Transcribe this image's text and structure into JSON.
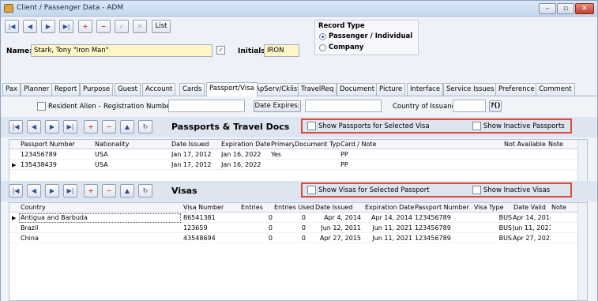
{
  "window": {
    "title": "Client / Passenger Data - ADM"
  },
  "toolbar": {
    "list_label": "List"
  },
  "name": {
    "label": "Name:",
    "value": "Stark, Tony \"Iron Man\"",
    "initials_label": "Initials:",
    "initials_value": "IRON"
  },
  "record_type": {
    "label": "Record Type",
    "options": [
      "Passenger / Individual",
      "Company"
    ],
    "selected": "Passenger / Individual"
  },
  "tabs": [
    "Pax",
    "Planner",
    "Report",
    "Purpose",
    "Guest",
    "Account",
    "Cards",
    "Passport/Visa",
    "ApServ/Cklist",
    "TravelReq",
    "Document",
    "Picture",
    "Interface",
    "Service Issues",
    "Preference",
    "Comment"
  ],
  "active_tab": "Passport/Visa",
  "resident": {
    "resident_alien_label": "Resident Alien -",
    "registration_label": "Registration Number:",
    "date_expires_label": "Date Expires:",
    "country_label": "Country of Issuance:",
    "lookup_label": "?()"
  },
  "passports": {
    "title": "Passports & Travel Docs",
    "show_selected_label": "Show Passports for Selected Visa",
    "show_inactive_label": "Show Inactive Passports",
    "columns": [
      "Passport Number",
      "Nationality",
      "Date Issued",
      "Expiration Date",
      "Primary",
      "Document Type",
      "Card / Note",
      "Not Available",
      "Note"
    ],
    "rows": [
      [
        "123456789",
        "USA",
        "Jan 17, 2012",
        "Jan 16, 2022",
        "Yes",
        "PP",
        "",
        "",
        ""
      ],
      [
        "135438439",
        "USA",
        "Jan 17, 2012",
        "Jan 16, 2022",
        "",
        "PP",
        "",
        "",
        ""
      ]
    ]
  },
  "visas": {
    "title": "Visas",
    "show_selected_label": "Show Visas for Selected Passport",
    "show_inactive_label": "Show Inactive Visas",
    "columns": [
      "Country",
      "Visa Number",
      "Entries",
      "Entries Used",
      "Date Issued",
      "Expiration Date",
      "Passport Number",
      "Visa Type",
      "Date Valid",
      "Note"
    ],
    "rows": [
      [
        "Antigua and Barbuda",
        "86541381",
        "0",
        "0",
        "Apr 4, 2014",
        "Apr 14, 2014",
        "123456789",
        "BUS",
        "Apr 14, 2014",
        ""
      ],
      [
        "Brazil",
        "123659",
        "0",
        "0",
        "Jun 12, 2011",
        "Jun 11, 2021",
        "123456789",
        "BUS",
        "Jun 11, 2021",
        ""
      ],
      [
        "China",
        "43548694",
        "0",
        "0",
        "Apr 27, 2015",
        "Jun 11, 2021",
        "123456789",
        "BUS",
        "Apr 27, 2025",
        ""
      ]
    ]
  },
  "icons": {
    "first": "first-record-icon",
    "prev": "previous-record-icon",
    "next": "next-record-icon",
    "last": "last-record-icon",
    "add": "add-record-icon",
    "delete": "delete-record-icon",
    "save": "save-check-icon",
    "cancel": "cancel-x-icon",
    "up": "move-up-icon",
    "refresh": "refresh-icon"
  },
  "colors": {
    "name_field_bg": "#fff6c8",
    "highlight_box": "#d94a3a",
    "add_red": "#d63c1d"
  }
}
